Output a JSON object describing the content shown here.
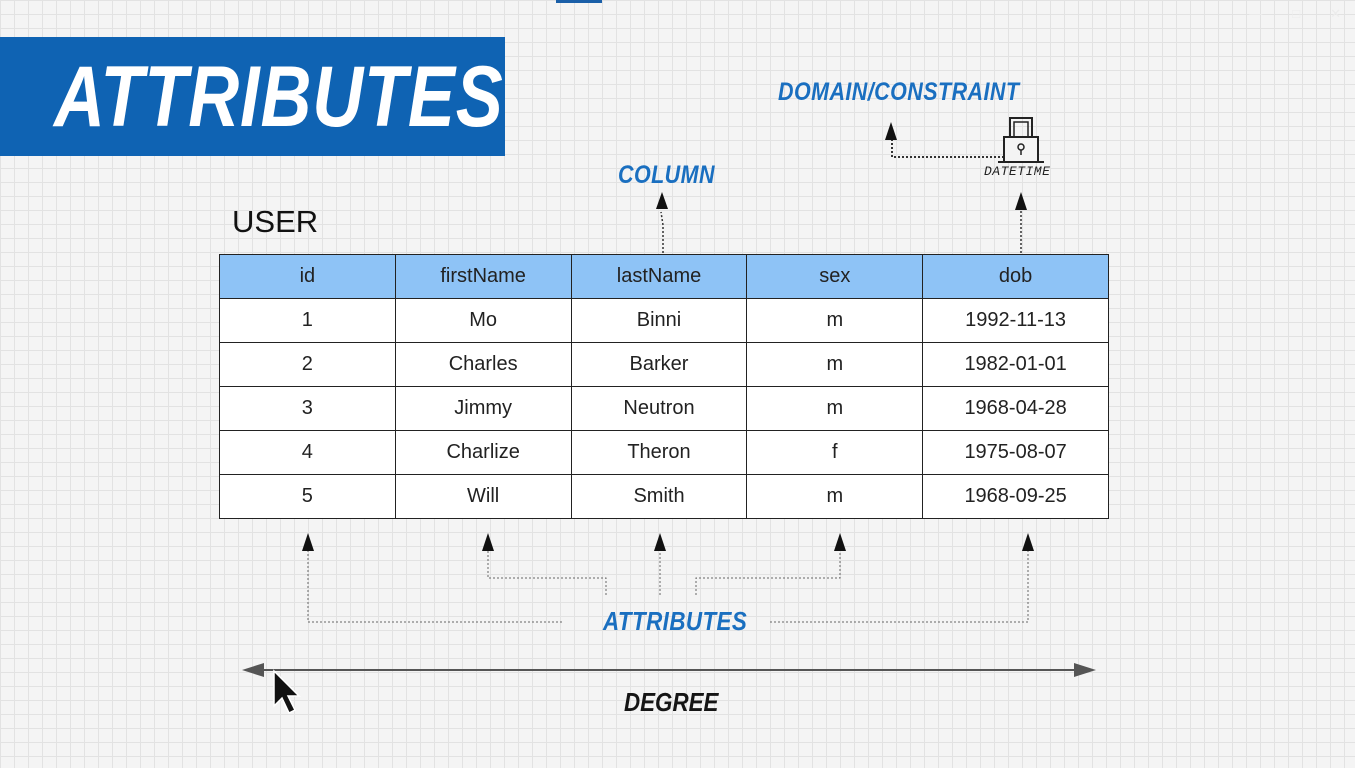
{
  "banner": {
    "title": "ATTRIBUTES"
  },
  "table": {
    "name": "USER",
    "columns": [
      "id",
      "firstName",
      "lastName",
      "sex",
      "dob"
    ],
    "rows": [
      [
        "1",
        "Mo",
        "Binni",
        "m",
        "1992-11-13"
      ],
      [
        "2",
        "Charles",
        "Barker",
        "m",
        "1982-01-01"
      ],
      [
        "3",
        "Jimmy",
        "Neutron",
        "m",
        "1968-04-28"
      ],
      [
        "4",
        "Charlize",
        "Theron",
        "f",
        "1975-08-07"
      ],
      [
        "5",
        "Will",
        "Smith",
        "m",
        "1968-09-25"
      ]
    ]
  },
  "annotations": {
    "domain_constraint": "DOMAIN/CONSTRAINT",
    "datetime": "DATETIME",
    "column": "COLUMN",
    "attributes": "ATTRIBUTES",
    "degree": "DEGREE"
  },
  "icons": {
    "lock": "lock-icon",
    "cursor": "mouse-cursor-icon"
  },
  "colors": {
    "banner_bg": "#0f63b3",
    "header_bg": "#8ec3f6",
    "label_blue": "#1a6fc0"
  }
}
